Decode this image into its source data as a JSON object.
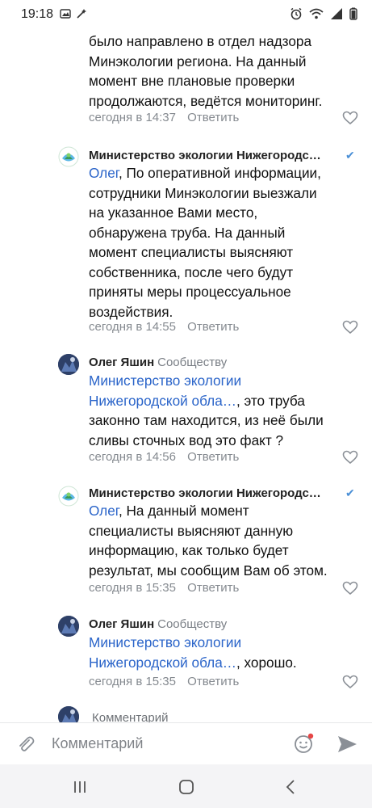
{
  "status_bar": {
    "time": "19:18"
  },
  "comments": [
    {
      "text_lines": [
        "было направлено в отдел надзора",
        "Минэкологии региона. На данный",
        "момент вне плановые проверки",
        "продолжаются, ведётся мониторинг."
      ],
      "time": "сегодня в 14:37",
      "reply": "Ответить"
    },
    {
      "author": "Министерство экологии Нижегородс…",
      "mention": "Олег",
      "text_first": ", По оперативной информации,",
      "text_lines": [
        "сотрудники Минэкологии выезжали",
        "на указанное Вами место,",
        "обнаружена труба.  На данный",
        "момент специалисты выясняют",
        "собственника, после чего будут",
        "приняты меры процессуальное",
        "воздействия."
      ],
      "time": "сегодня в 14:55",
      "reply": "Ответить"
    },
    {
      "author": "Олег Яшин",
      "to": "Сообществу",
      "mention_lines": [
        "Министерство экологии",
        "Нижегородской обла…"
      ],
      "text_first": ", это труба",
      "text_lines": [
        "законно там находится, из неё были",
        "сливы сточных вод это факт ?"
      ],
      "time": "сегодня в 14:56",
      "reply": "Ответить"
    },
    {
      "author": "Министерство экологии Нижегородс…",
      "mention": "Олег",
      "text_first": ", На данный момент",
      "text_lines": [
        "специалисты выясняют данную",
        "информацию, как только будет",
        "результат, мы сообщим Вам об этом."
      ],
      "time": "сегодня в 15:35",
      "reply": "Ответить"
    },
    {
      "author": "Олег Яшин",
      "to": "Сообществу",
      "mention_lines": [
        "Министерство экологии",
        "Нижегородской обла…"
      ],
      "text_first": ", хорошо.",
      "time": "сегодня в 15:35",
      "reply": "Ответить"
    }
  ],
  "partial_hint": "Комментарий",
  "composer": {
    "placeholder": "Комментарий"
  },
  "colors": {
    "link": "#2a64c9",
    "meta": "#858a90",
    "accent": "#4a8fd6"
  }
}
